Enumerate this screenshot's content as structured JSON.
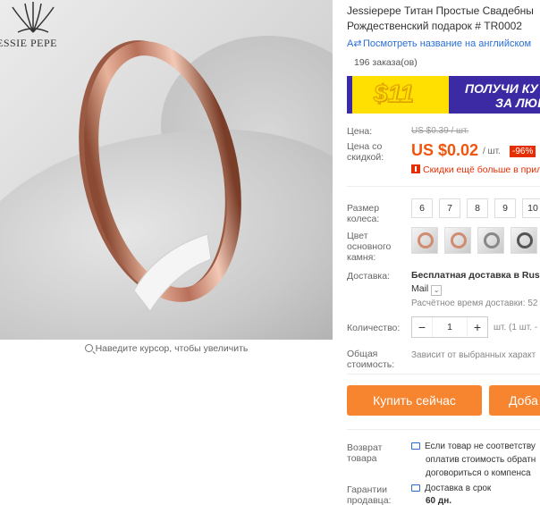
{
  "brand": {
    "logo_text": "ESSIE PEPE"
  },
  "gallery": {
    "zoom_hint": "Наведите курсор, чтобы увеличить"
  },
  "product": {
    "title_line1": "Jessiepepe Титан Простые Свадебны",
    "title_line2": "Рождественский подарок # TR0002",
    "translate_link": "Посмотреть название на английском",
    "orders": "196 заказа(ов)"
  },
  "banner": {
    "amount": "$11",
    "line1": "ПОЛУЧИ КУ",
    "line2": "ЗА ЛЮБ"
  },
  "price": {
    "label": "Цена:",
    "old": "US $0.39 / шт.",
    "discount_label": "Цена со скидкой:",
    "new": "US $0.02",
    "per_unit": "/ шт.",
    "discount_pct": "-96%",
    "app_deal": "Скидки ещё больше в прил"
  },
  "options": {
    "size_label": "Размер колеса:",
    "sizes": [
      "6",
      "7",
      "8",
      "9",
      "10"
    ],
    "stone_label": "Цвет основного камня:"
  },
  "shipping": {
    "label": "Доставка:",
    "free": "Бесплатная доставка в Russi",
    "method": "Mail",
    "estimate": "Расчётное время доставки: 52"
  },
  "quantity": {
    "label": "Количество:",
    "value": "1",
    "minus": "−",
    "plus": "+",
    "note": "шт. (1 шт. -"
  },
  "total": {
    "label": "Общая стоимость:",
    "note": "Зависит от выбранных характ"
  },
  "actions": {
    "buy": "Купить сейчас",
    "cart": "Доба"
  },
  "returns": {
    "label": "Возврат товара",
    "line1": "Если товар не соответству",
    "line2": "оплатив стоимость обратн",
    "line3": "договориться о компенса"
  },
  "guarantee": {
    "label": "Гарантии продавца:",
    "line1": "Доставка в срок",
    "line2": "60 дн."
  },
  "colors": {
    "accent": "#f0550e",
    "button": "#f7842f",
    "link": "#2a6ed5",
    "ring": "#c98a70"
  }
}
